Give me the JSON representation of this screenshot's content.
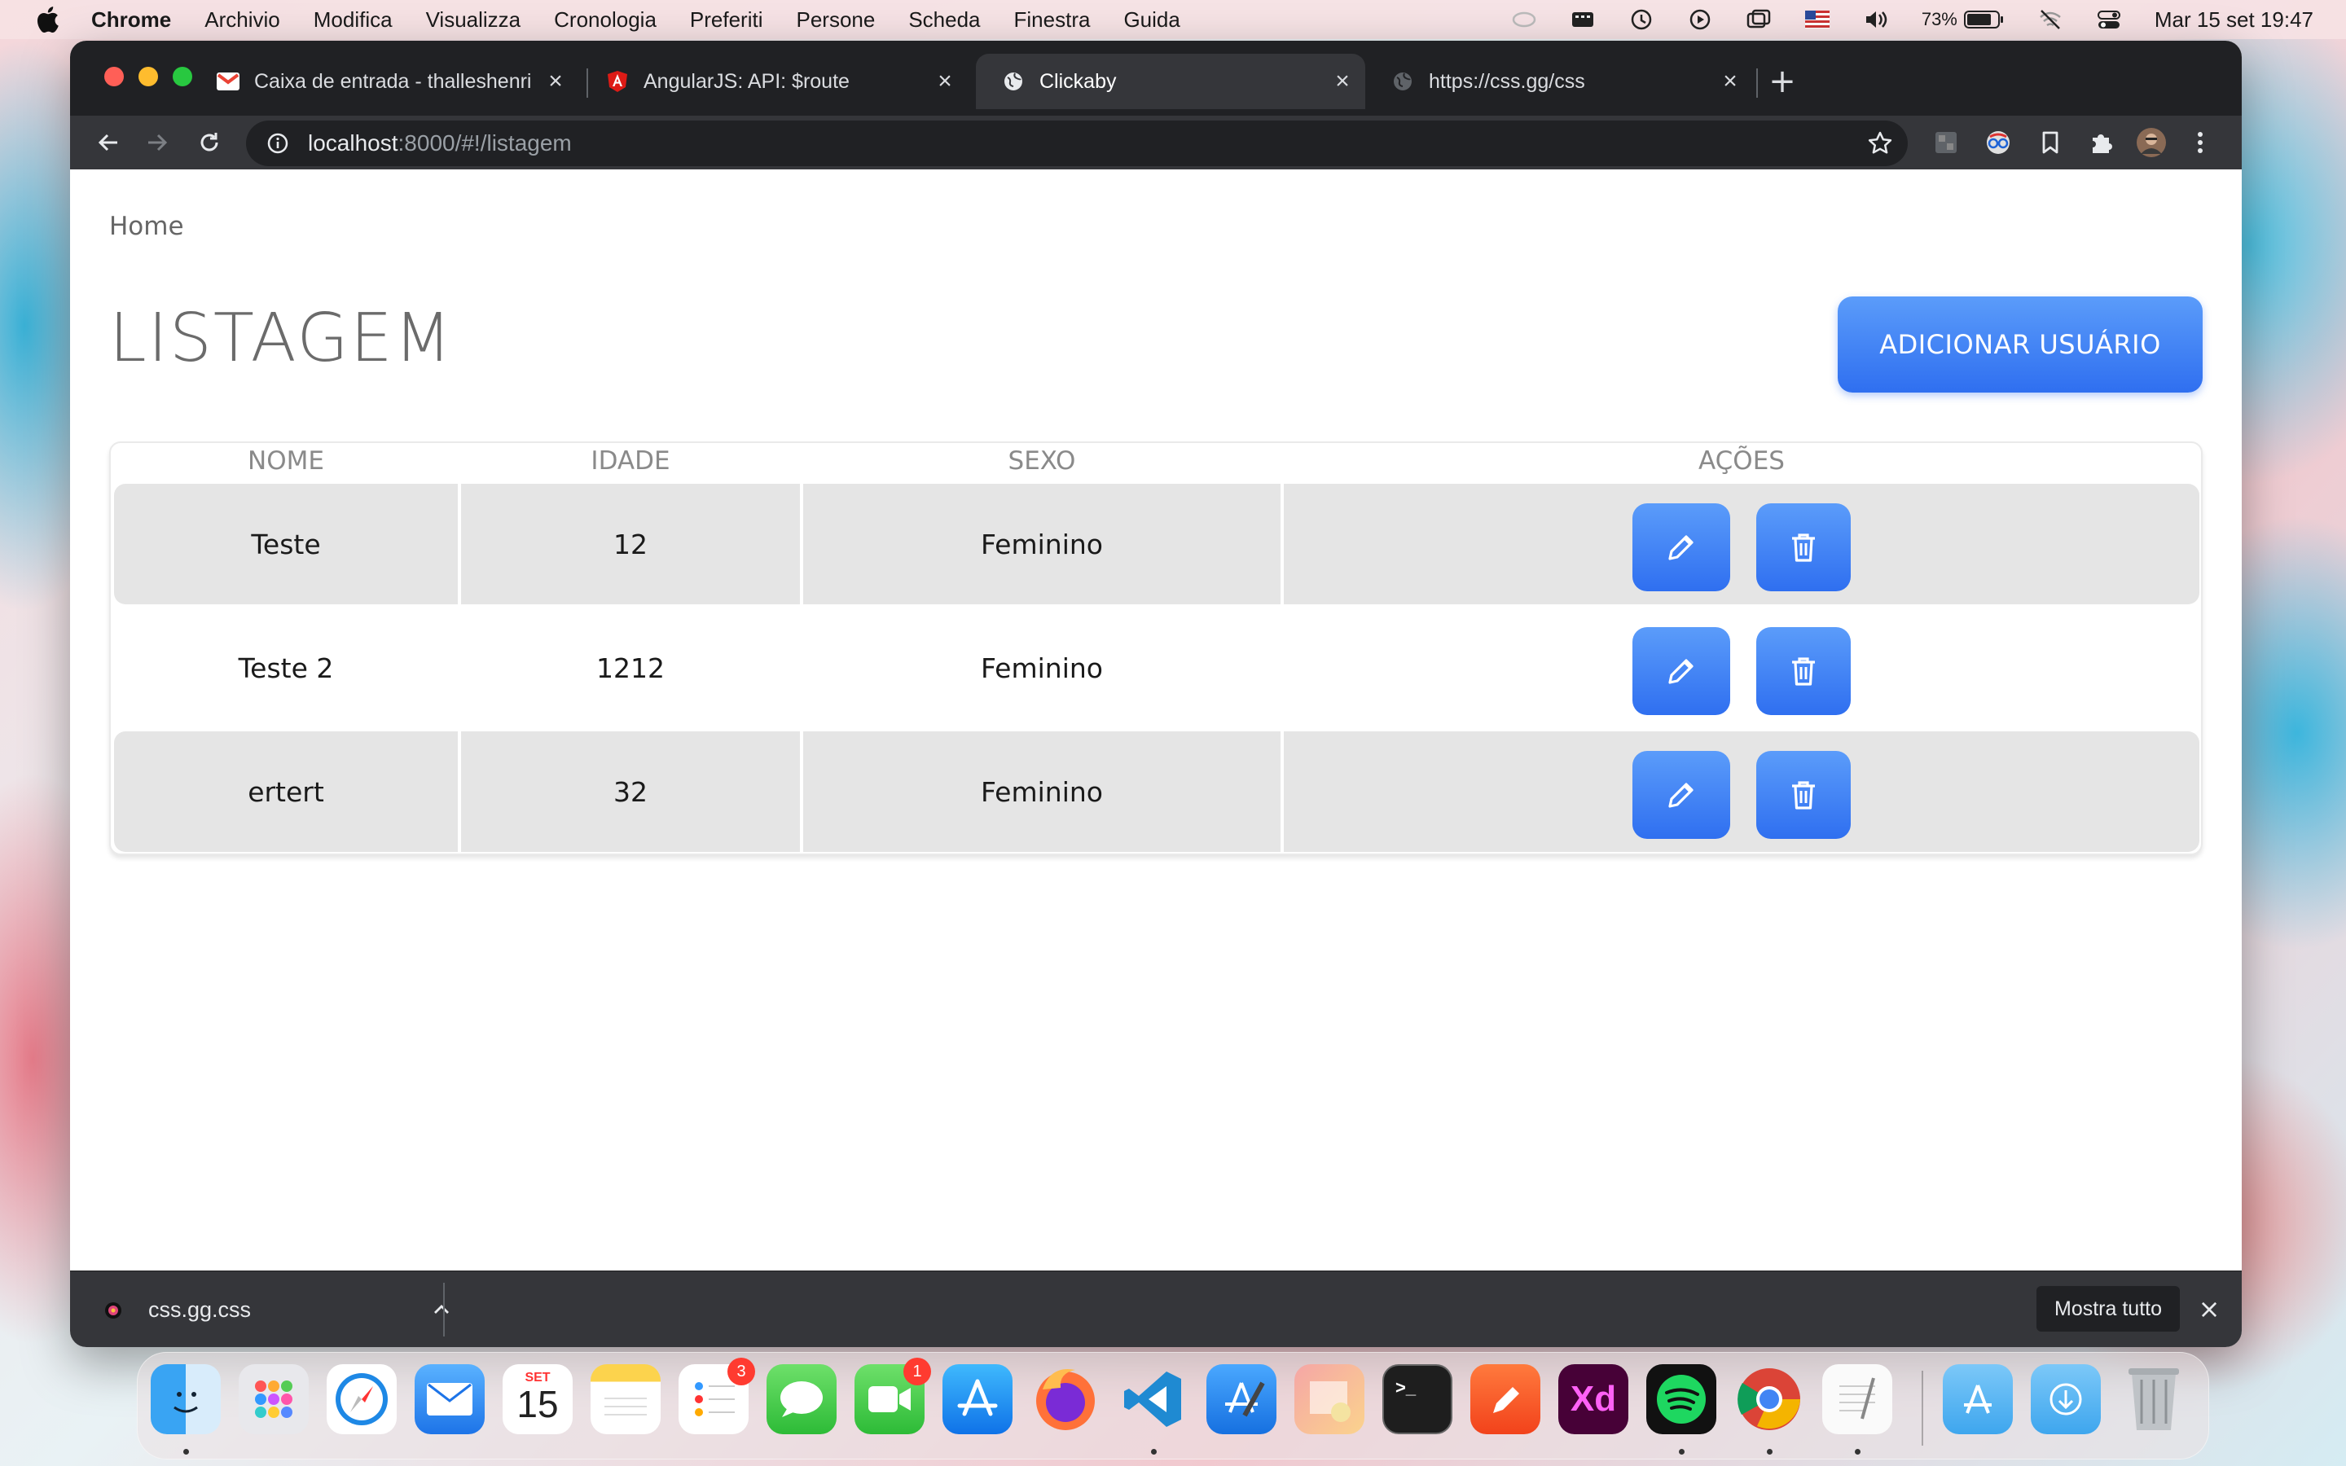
{
  "menubar": {
    "items": [
      "Chrome",
      "Archivio",
      "Modifica",
      "Visualizza",
      "Cronologia",
      "Preferiti",
      "Persone",
      "Scheda",
      "Finestra",
      "Guida"
    ],
    "battery": "73%",
    "datetime": "Mar 15 set  19:47"
  },
  "browser": {
    "tabs": [
      {
        "title": "Caixa de entrada - thalleshenri",
        "icon": "gmail-icon"
      },
      {
        "title": "AngularJS: API: $route",
        "icon": "angular-icon"
      },
      {
        "title": "Clickaby",
        "icon": "globe-icon"
      },
      {
        "title": "https://css.gg/css",
        "icon": "globe-icon"
      }
    ],
    "url_host": "localhost",
    "url_rest": ":8000/#!/listagem"
  },
  "page": {
    "breadcrumb": "Home",
    "title": "LISTAGEM",
    "add_button": "ADICIONAR USUÁRIO",
    "columns": [
      "NOME",
      "IDADE",
      "SEXO",
      "AÇÕES"
    ],
    "rows": [
      {
        "nome": "Teste",
        "idade": "12",
        "sexo": "Feminino"
      },
      {
        "nome": "Teste 2",
        "idade": "1212",
        "sexo": "Feminino"
      },
      {
        "nome": "ertert",
        "idade": "32",
        "sexo": "Feminino"
      }
    ]
  },
  "downloads": {
    "file": "css.gg.css",
    "show_all": "Mostra tutto"
  },
  "dock": {
    "calendar_month": "SET",
    "calendar_day": "15",
    "reminders_badge": "3",
    "facetime_badge": "1",
    "xd_label": "Xd"
  },
  "colors": {
    "accent": "#3b7ff5",
    "row_gray": "#e5e5e5",
    "title_gray": "#6b6b6b"
  }
}
